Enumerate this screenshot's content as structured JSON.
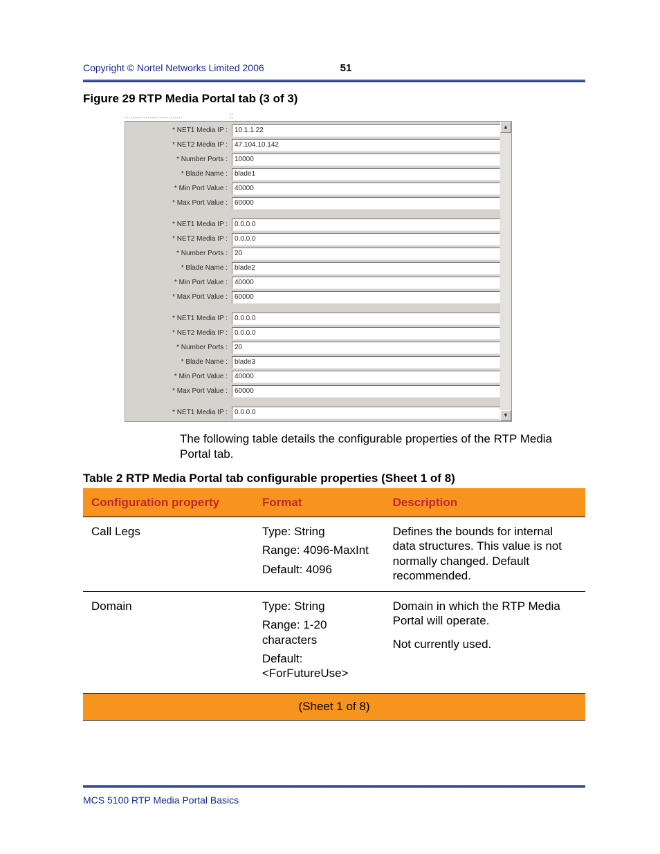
{
  "header": {
    "copyright": "Copyright © Nortel Networks Limited 2006",
    "page_number": "51"
  },
  "figure_caption": "Figure 29  RTP Media Portal tab (3 of 3)",
  "screenshot": {
    "groups": [
      {
        "net1": "10.1.1.22",
        "net2": "47.104.10.142",
        "ports": "10000",
        "blade": "blade1",
        "min": "40000",
        "max": "60000"
      },
      {
        "net1": "0.0.0.0",
        "net2": "0.0.0.0",
        "ports": "20",
        "blade": "blade2",
        "min": "40000",
        "max": "60000"
      },
      {
        "net1": "0.0.0.0",
        "net2": "0.0.0.0",
        "ports": "20",
        "blade": "blade3",
        "min": "40000",
        "max": "60000"
      }
    ],
    "tail_net1": "0.0.0.0",
    "labels": {
      "net1": "* NET1 Media IP :",
      "net2": "* NET2 Media IP :",
      "ports": "* Number Ports :",
      "blade": "* Blade Name :",
      "min": "* Min Port Value :",
      "max": "* Max Port Value :"
    }
  },
  "intro_text": "The following table details the configurable properties of the RTP Media Portal tab.",
  "table_caption": "Table 2  RTP Media Portal tab configurable properties (Sheet 1 of 8)",
  "table": {
    "headers": {
      "c1": "Configuration property",
      "c2": "Format",
      "c3": "Description"
    },
    "rows": [
      {
        "prop": "Call Legs",
        "fmt1": "Type: String",
        "fmt2": "Range: 4096-MaxInt",
        "fmt3": "Default: 4096",
        "desc": "Defines the bounds for internal data structures. This value is not normally changed. Default recommended."
      },
      {
        "prop": "Domain",
        "fmt1": "Type: String",
        "fmt2": "Range: 1-20 characters",
        "fmt3": "Default: <ForFutureUse>",
        "desc1": "Domain in which the RTP Media Portal will operate.",
        "desc2": "Not currently used."
      }
    ],
    "sheet": "(Sheet 1 of 8)"
  },
  "footer": "MCS 5100 RTP Media Portal Basics"
}
